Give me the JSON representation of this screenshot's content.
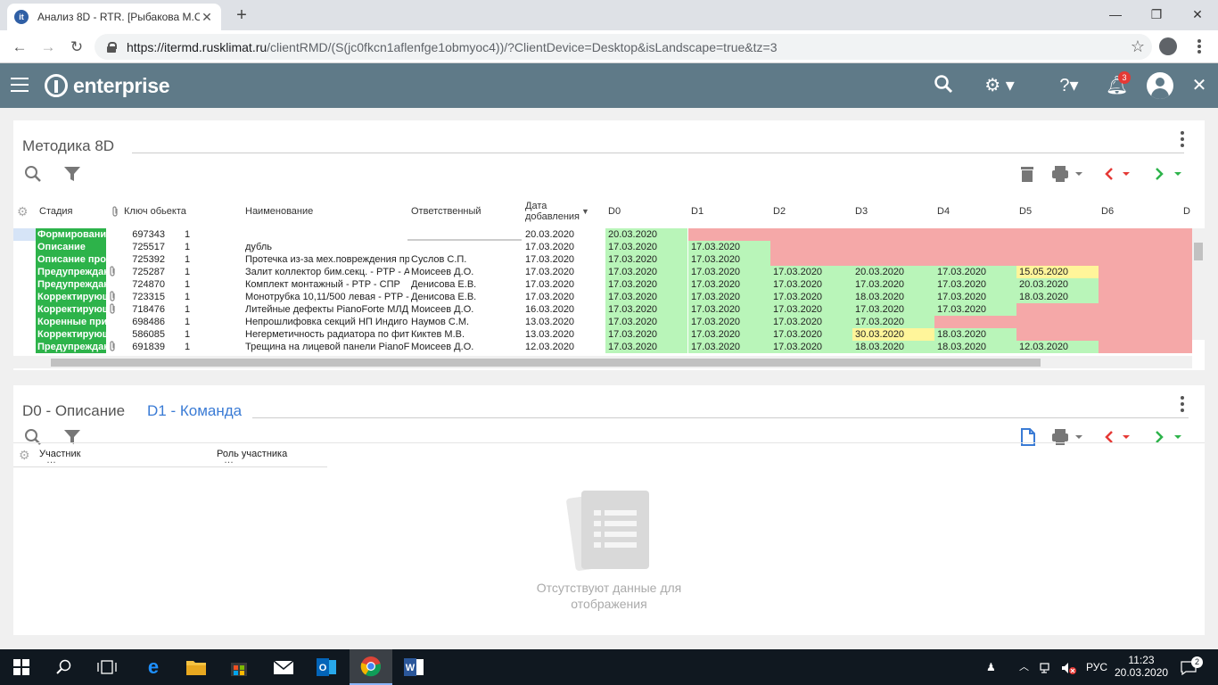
{
  "browser": {
    "tab_title": "Анализ 8D - RTR. [Рыбакова М.С",
    "url_host": "https://itermd.rusklimat.ru",
    "url_path": "/clientRMD/(S(jc0fkcn1aflenfge1obmyoc4))/?ClientDevice=Desktop&isLandscape=true&tz=3"
  },
  "app": {
    "brand": "enterprise",
    "notifications_count": "3",
    "colors": {
      "header": "#5f7a88",
      "stage_green": "#2db34a",
      "cell_green": "#b9f5b9",
      "cell_red": "#f5a8a8",
      "cell_yellow": "#fff59a",
      "active_tab": "#3a7bd5"
    }
  },
  "panel1": {
    "title": "Методика 8D",
    "columns": [
      "Стадия",
      "Ключ обьекта",
      "Наименование",
      "Ответственный",
      "Дата добавления",
      "D0",
      "D1",
      "D2",
      "D3",
      "D4",
      "D5",
      "D6",
      "D"
    ],
    "rows": [
      {
        "stage": "Формирование",
        "key": "697343",
        "n": "1",
        "name": "",
        "owner": "",
        "date": "20.03.2020",
        "clip": false,
        "d": [
          {
            "v": "20.03.2020",
            "c": "gr"
          },
          {
            "v": "",
            "c": "rd"
          },
          {
            "v": "",
            "c": "rd"
          },
          {
            "v": "",
            "c": "rd"
          },
          {
            "v": "",
            "c": "rd"
          },
          {
            "v": "",
            "c": "rd"
          },
          {
            "v": "",
            "c": "rd"
          }
        ]
      },
      {
        "stage": "Описание",
        "key": "725517",
        "n": "1",
        "name": "дубль",
        "owner": "",
        "date": "17.03.2020",
        "clip": false,
        "d": [
          {
            "v": "17.03.2020",
            "c": "gr"
          },
          {
            "v": "17.03.2020",
            "c": "gr"
          },
          {
            "v": "",
            "c": "rd"
          },
          {
            "v": "",
            "c": "rd"
          },
          {
            "v": "",
            "c": "rd"
          },
          {
            "v": "",
            "c": "rd"
          },
          {
            "v": "",
            "c": "rd"
          }
        ]
      },
      {
        "stage": "Описание пробл",
        "key": "725392",
        "n": "1",
        "name": "Протечка из-за мех.повреждения пр",
        "owner": "Суслов С.П.",
        "date": "17.03.2020",
        "clip": false,
        "d": [
          {
            "v": "17.03.2020",
            "c": "gr"
          },
          {
            "v": "17.03.2020",
            "c": "gr"
          },
          {
            "v": "",
            "c": "rd"
          },
          {
            "v": "",
            "c": "rd"
          },
          {
            "v": "",
            "c": "rd"
          },
          {
            "v": "",
            "c": "rd"
          },
          {
            "v": "",
            "c": "rd"
          }
        ]
      },
      {
        "stage": "Предупреждающ",
        "key": "725287",
        "n": "1",
        "name": "Залит коллектор бим.секц. - PTP - А",
        "owner": "Моисеев Д.О.",
        "date": "17.03.2020",
        "clip": true,
        "d": [
          {
            "v": "17.03.2020",
            "c": "gr"
          },
          {
            "v": "17.03.2020",
            "c": "gr"
          },
          {
            "v": "17.03.2020",
            "c": "gr"
          },
          {
            "v": "20.03.2020",
            "c": "gr"
          },
          {
            "v": "17.03.2020",
            "c": "gr"
          },
          {
            "v": "15.05.2020",
            "c": "yl"
          },
          {
            "v": "",
            "c": "rd"
          }
        ]
      },
      {
        "stage": "Предупреждающ",
        "key": "724870",
        "n": "1",
        "name": "Комплект монтажный - PTP - СПР",
        "owner": "Денисова Е.В.",
        "date": "17.03.2020",
        "clip": false,
        "d": [
          {
            "v": "17.03.2020",
            "c": "gr"
          },
          {
            "v": "17.03.2020",
            "c": "gr"
          },
          {
            "v": "17.03.2020",
            "c": "gr"
          },
          {
            "v": "17.03.2020",
            "c": "gr"
          },
          {
            "v": "17.03.2020",
            "c": "gr"
          },
          {
            "v": "20.03.2020",
            "c": "gr"
          },
          {
            "v": "",
            "c": "rd"
          }
        ]
      },
      {
        "stage": "Корректирующ",
        "key": "723315",
        "n": "1",
        "name": "Монотрубка 10,11/500 левая - PTP -",
        "owner": "Денисова Е.В.",
        "date": "17.03.2020",
        "clip": true,
        "d": [
          {
            "v": "17.03.2020",
            "c": "gr"
          },
          {
            "v": "17.03.2020",
            "c": "gr"
          },
          {
            "v": "17.03.2020",
            "c": "gr"
          },
          {
            "v": "18.03.2020",
            "c": "gr"
          },
          {
            "v": "17.03.2020",
            "c": "gr"
          },
          {
            "v": "18.03.2020",
            "c": "gr"
          },
          {
            "v": "",
            "c": "rd"
          }
        ]
      },
      {
        "stage": "Корректирующ",
        "key": "718476",
        "n": "1",
        "name": "Литейные дефекты PianoForte МЛД",
        "owner": "Моисеев Д.О.",
        "date": "16.03.2020",
        "clip": true,
        "d": [
          {
            "v": "17.03.2020",
            "c": "gr"
          },
          {
            "v": "17.03.2020",
            "c": "gr"
          },
          {
            "v": "17.03.2020",
            "c": "gr"
          },
          {
            "v": "17.03.2020",
            "c": "gr"
          },
          {
            "v": "17.03.2020",
            "c": "gr"
          },
          {
            "v": "",
            "c": "rd"
          },
          {
            "v": "",
            "c": "rd"
          }
        ]
      },
      {
        "stage": "Коренные прич",
        "key": "698486",
        "n": "1",
        "name": "Непрошлифовка секций НП Индиго",
        "owner": "Наумов С.М.",
        "date": "13.03.2020",
        "clip": false,
        "d": [
          {
            "v": "17.03.2020",
            "c": "gr"
          },
          {
            "v": "17.03.2020",
            "c": "gr"
          },
          {
            "v": "17.03.2020",
            "c": "gr"
          },
          {
            "v": "17.03.2020",
            "c": "gr"
          },
          {
            "v": "",
            "c": "rd"
          },
          {
            "v": "",
            "c": "rd"
          },
          {
            "v": "",
            "c": "rd"
          }
        ]
      },
      {
        "stage": "Корректирующ",
        "key": "586085",
        "n": "1",
        "name": "Негерметичность радиатора по фит",
        "owner": "Киктев М.В.",
        "date": "13.03.2020",
        "clip": false,
        "d": [
          {
            "v": "17.03.2020",
            "c": "gr"
          },
          {
            "v": "17.03.2020",
            "c": "gr"
          },
          {
            "v": "17.03.2020",
            "c": "gr"
          },
          {
            "v": "30.03.2020",
            "c": "yl"
          },
          {
            "v": "18.03.2020",
            "c": "gr"
          },
          {
            "v": "",
            "c": "rd"
          },
          {
            "v": "",
            "c": "rd"
          }
        ]
      },
      {
        "stage": "Предупреждающ",
        "key": "691839",
        "n": "1",
        "name": "Трещина на лицевой панели PianoFo",
        "owner": "Моисеев Д.О.",
        "date": "12.03.2020",
        "clip": true,
        "d": [
          {
            "v": "17.03.2020",
            "c": "gr"
          },
          {
            "v": "17.03.2020",
            "c": "gr"
          },
          {
            "v": "17.03.2020",
            "c": "gr"
          },
          {
            "v": "18.03.2020",
            "c": "gr"
          },
          {
            "v": "18.03.2020",
            "c": "gr"
          },
          {
            "v": "12.03.2020",
            "c": "gr"
          },
          {
            "v": "",
            "c": "rd"
          }
        ]
      }
    ]
  },
  "panel2": {
    "tab_d0": "D0 - Описание",
    "tab_d1": "D1 - Команда",
    "columns": [
      "Участник",
      "Роль участника"
    ],
    "empty_line1": "Отсутствуют данные для",
    "empty_line2": "отображения"
  },
  "taskbar": {
    "lang": "РУС",
    "time": "11:23",
    "date": "20.03.2020",
    "notif_count": "2"
  }
}
